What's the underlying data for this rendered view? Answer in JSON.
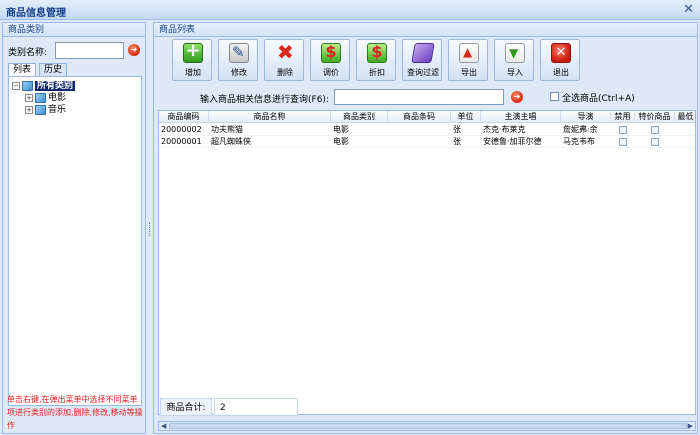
{
  "window": {
    "title": "商品信息管理",
    "close_glyph": "✕"
  },
  "left": {
    "panel_title": "商品类别",
    "category_label": "类别名称:",
    "category_value": "",
    "tabs": [
      "列表",
      "历史"
    ],
    "tree": {
      "root": "所有类别",
      "children": [
        "电影",
        "音乐"
      ]
    },
    "hint": "单击右键,在弹出菜单中选择不同菜单项进行类别的添加,删除,修改,移动等操作"
  },
  "right": {
    "panel_title": "商品列表",
    "toolbar": [
      {
        "label": "增加",
        "icon": "add-icon"
      },
      {
        "label": "修改",
        "icon": "edit-icon"
      },
      {
        "label": "删除",
        "icon": "delete-icon"
      },
      {
        "label": "调价",
        "icon": "money-icon"
      },
      {
        "label": "折扣",
        "icon": "money-icon"
      },
      {
        "label": "查询过滤",
        "icon": "filter-icon"
      },
      {
        "label": "导出",
        "icon": "export-icon"
      },
      {
        "label": "导入",
        "icon": "import-icon"
      },
      {
        "label": "退出",
        "icon": "exit-icon"
      }
    ],
    "search_label": "输入商品相关信息进行查询(F6):",
    "search_value": "",
    "select_all_label": "全选商品(Ctrl+A)",
    "columns": [
      "商品编码",
      "商品名称",
      "商品类别",
      "商品条码",
      "单位",
      "主演主唱",
      "导演",
      "禁用",
      "特价商品",
      "最低"
    ],
    "rows": [
      [
        "20000002",
        "功夫熊猫",
        "电影",
        "",
        "张",
        "杰克·布莱克",
        "詹妮弗·余"
      ],
      [
        "20000001",
        "超凡蜘蛛侠",
        "电影",
        "",
        "张",
        "安德鲁·加菲尔德",
        "马克韦布"
      ]
    ],
    "total_label": "商品合计:",
    "total_value": "2"
  },
  "colors": {
    "accent": "#15428b",
    "panel": "#dfe8f6",
    "border": "#99bbe8",
    "hint": "#e02020"
  }
}
